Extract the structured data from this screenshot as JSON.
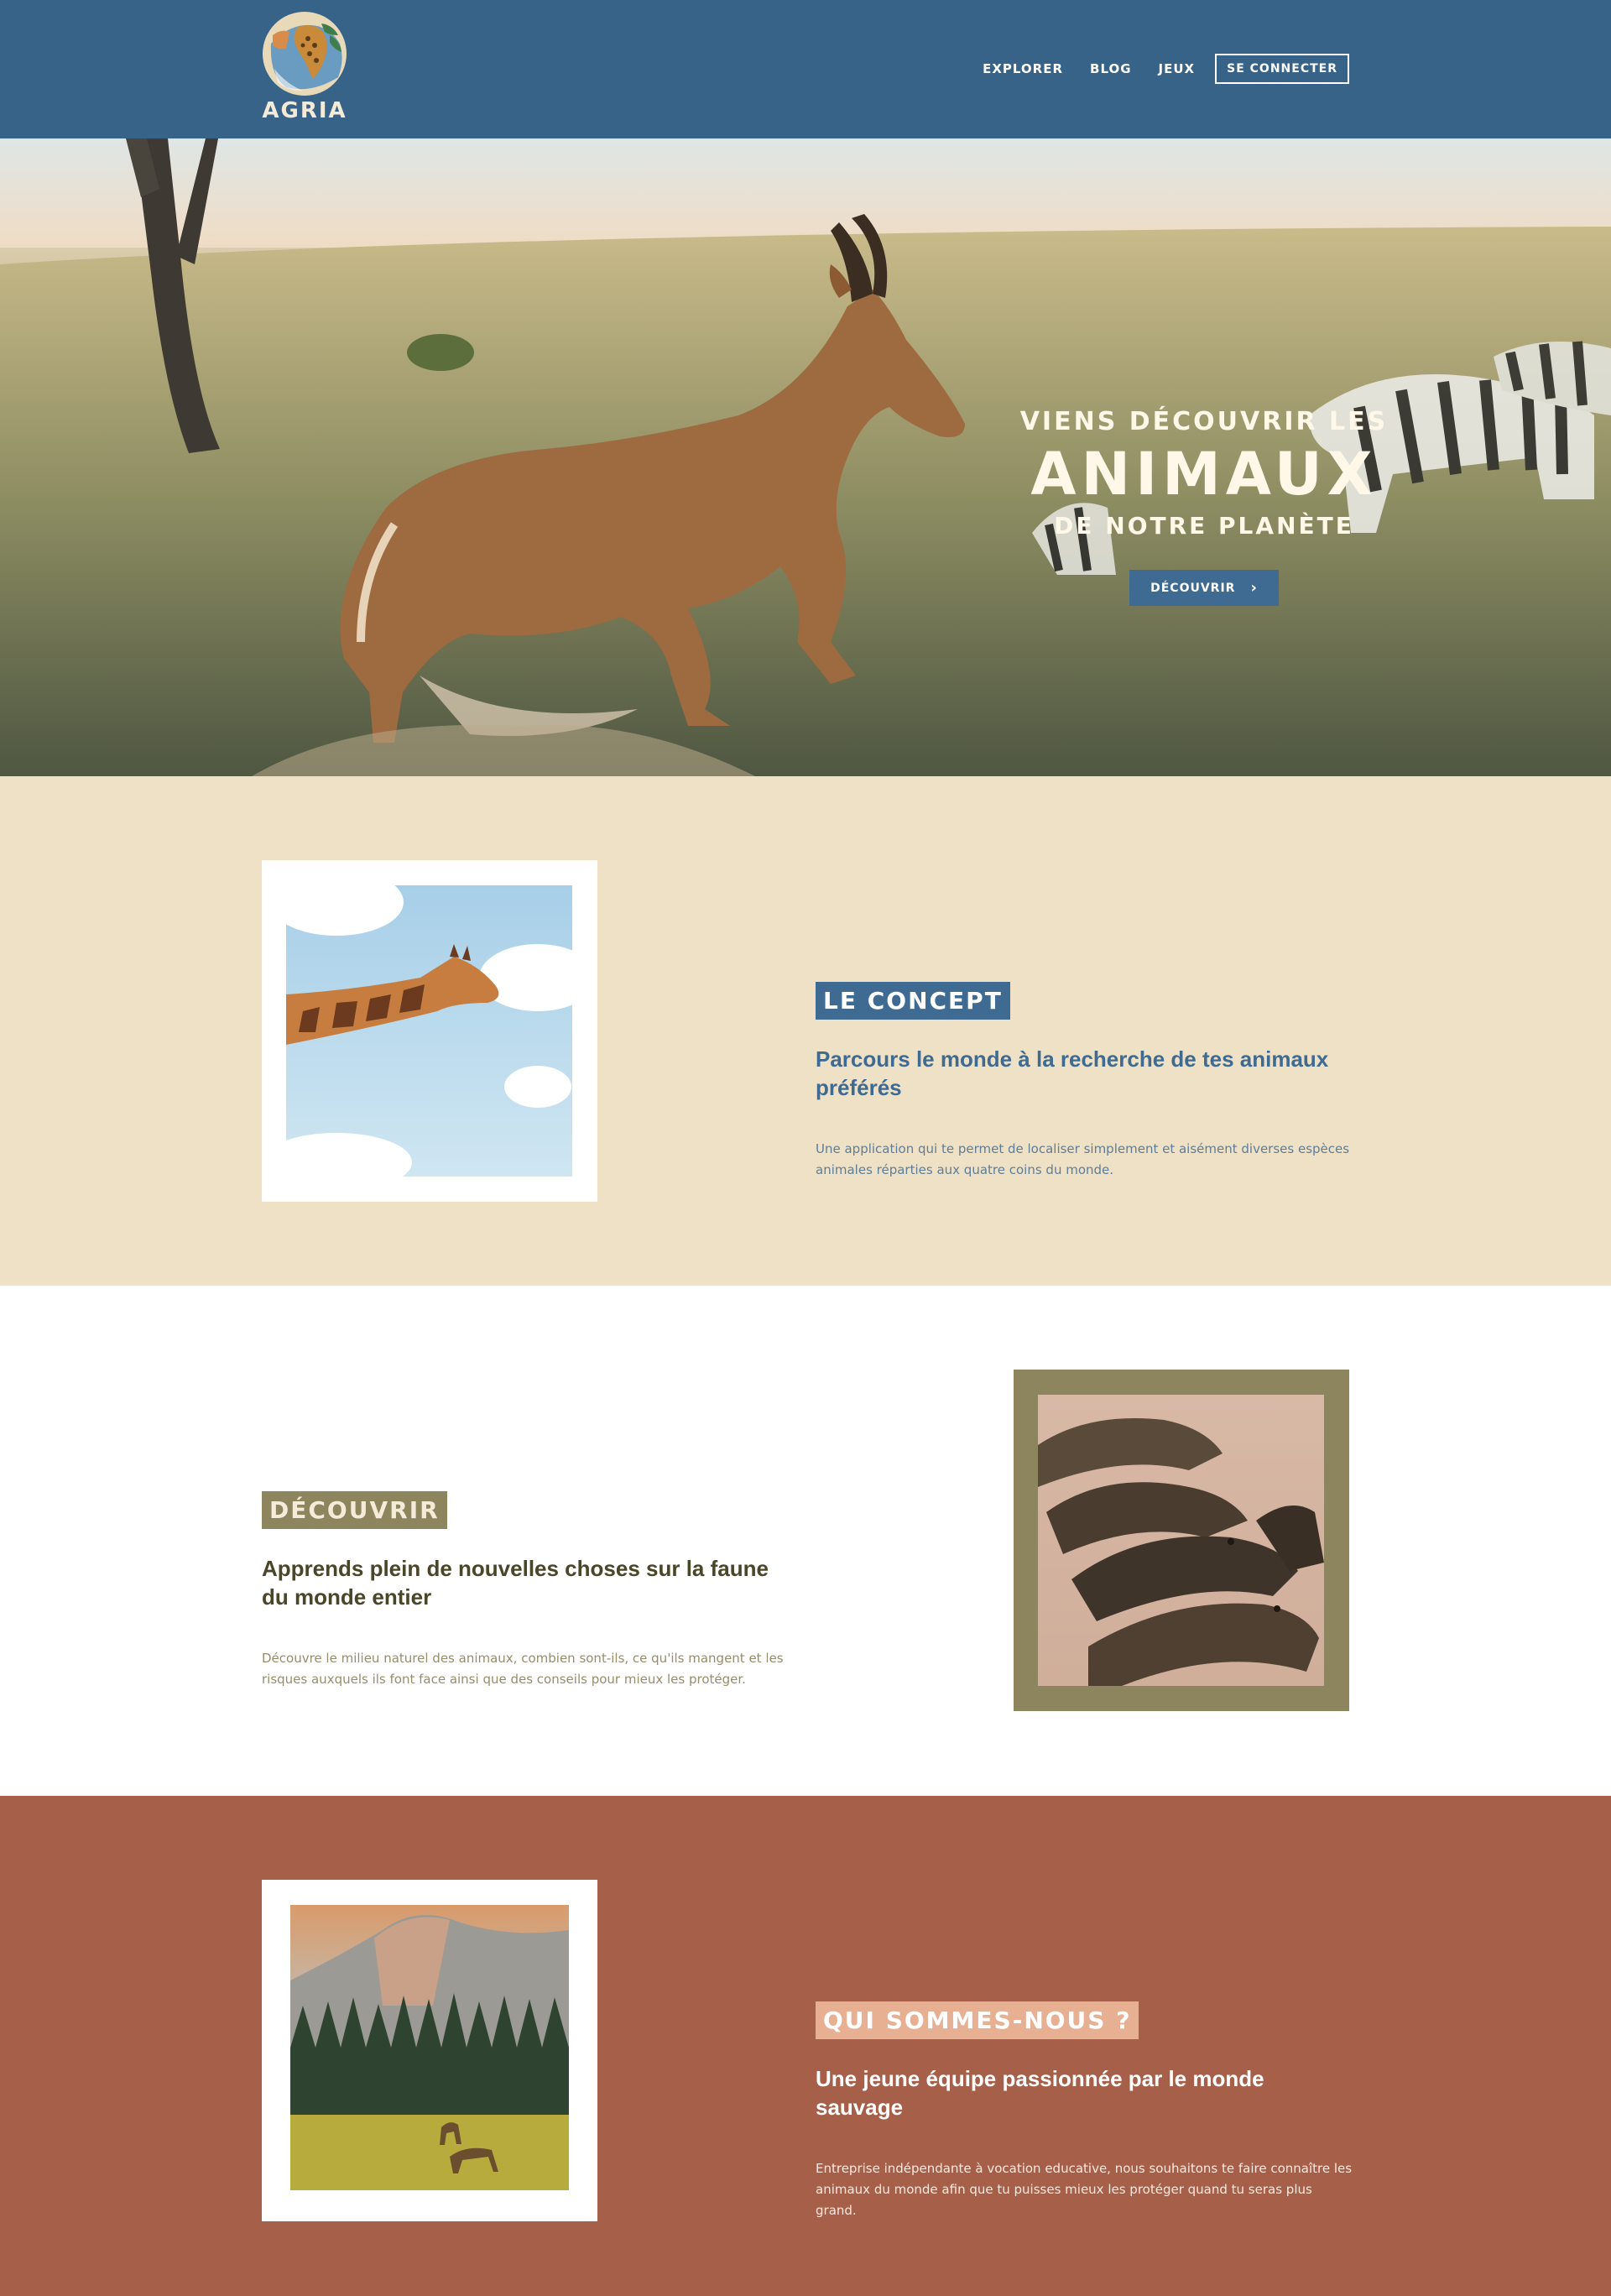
{
  "brand": {
    "name": "AGRIA"
  },
  "nav": {
    "links": [
      "Explorer",
      "Blog",
      "Jeux"
    ],
    "login": "Se connecter"
  },
  "hero": {
    "line1": "Viens découvrir les",
    "line2": "Animaux",
    "line3": "de notre planète",
    "button": "Découvrir"
  },
  "concept": {
    "tag": "Le concept",
    "heading": "Parcours le monde à la recherche de tes animaux préférés",
    "text": "Une application qui te permet de localiser simplement et aisément diverses espèces animales réparties aux quatre coins du monde."
  },
  "discover": {
    "tag": "Découvrir",
    "heading": "Apprends plein de nouvelles choses sur la faune du monde entier",
    "text": "Découvre le milieu naturel des animaux, combien sont-ils, ce qu'ils mangent et les risques auxquels ils font face ainsi que des conseils pour mieux les protéger."
  },
  "about": {
    "tag": "Qui sommes-nous ?",
    "heading": "Une jeune équipe passionnée par le monde sauvage",
    "text": "Entreprise indépendante à vocation educative, nous souhaitons te faire connaître les animaux du monde afin que tu puisses mieux les protéger quand tu seras plus grand."
  },
  "colors": {
    "header": "#376388",
    "concept_bg": "#eee1c5",
    "concept_accent": "#3f6b92",
    "discover_accent": "#8c855e",
    "discover_text": "#4a4628",
    "about_bg": "#a66049",
    "about_tag": "#e7b093"
  },
  "icons": {
    "logo": "globe-africa-logo",
    "button_arrow": "chevron-right-icon"
  }
}
